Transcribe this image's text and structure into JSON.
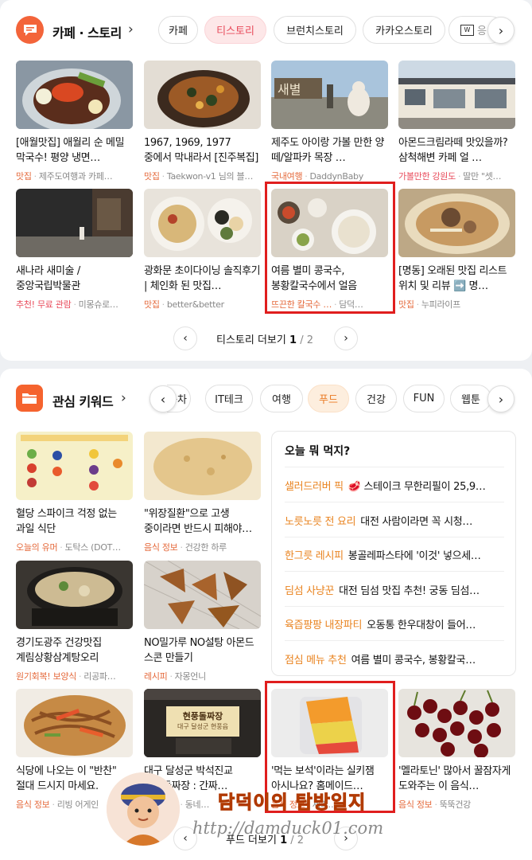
{
  "section1": {
    "title": "카페 · 스토리",
    "chips": [
      "카페",
      "티스토리",
      "브런치스토리",
      "카카오스토리",
      "응"
    ],
    "tiles": [
      {
        "title": "[애월맛집] 애월리 순 메밀 막국수! 평양 냉면…",
        "cat": "맛집",
        "author": "제주도여행과 카페…"
      },
      {
        "title": "1967, 1969, 1977 중에서 막내라서 [진주복집]으…",
        "cat": "맛집",
        "author": "Taekwon-v1 님의 블…"
      },
      {
        "title": "제주도 아이랑 가볼 만한 양 떼/알파카 목장 …",
        "cat": "국내여행",
        "author": "DaddynBaby"
      },
      {
        "title": "아몬드크림라떼 맛있을까? 삼척해변 카페 얼 …",
        "cat": "가볼만한 강원도",
        "author": "딸만 \"셋…"
      },
      {
        "title": "새나라 새미술 / 중앙국립박물관",
        "cat": "추천! 무료 관람",
        "author": "미몽슈로…"
      },
      {
        "title": "광화문 초이다이닝 솔직후기 | 체인화 된 맛집…",
        "cat": "맛집",
        "author": "better&better"
      },
      {
        "title": "여름 별미 콩국수, 봉황칼국수에서 얼음 동동…",
        "cat": "뜨끈한 칼국수 …",
        "author": "담덕…"
      },
      {
        "title": "[명동] 오래된 맛집 리스트 위치 및 리뷰 ➡️ 명…",
        "cat": "맛집",
        "author": "누피라이프"
      }
    ],
    "pager": {
      "label": "티스토리 더보기",
      "current": "1",
      "total": "/ 2"
    }
  },
  "section2": {
    "title": "관심 키워드",
    "chips": [
      "동차",
      "IT테크",
      "여행",
      "푸드",
      "건강",
      "FUN",
      "웹툰"
    ],
    "tiles": [
      {
        "title": "혈당 스파이크 걱정 없는 과일 식단",
        "cat": "오늘의 유머",
        "author": "도탁스 (DOT…"
      },
      {
        "title": "\"위장질환\"으로 고생 중이라면 반드시 피해야…",
        "cat": "음식 정보",
        "author": "건강한 하루"
      },
      {
        "title": "경기도광주 건강맛집 계림상황삼계탕오리",
        "cat": "원기회복! 보양식",
        "author": "리공파…"
      },
      {
        "title": "NO밀가루 NO설탕 아몬드 스콘 만들기",
        "cat": "레시피",
        "author": "자몽언니"
      },
      {
        "title": "식당에 나오는 이 \"반찬\" 절대 드시지 마세요.",
        "cat": "음식 정보",
        "author": "리빙 어게인"
      },
      {
        "title": "대구 달성군 박석진교 현풍돌짜장 : 간짜…",
        "cat": "맛집 탐방",
        "author": "동네…"
      },
      {
        "title": "'먹는 보석'이라는 실키잼 아시나요? 홈메이드…",
        "cat": "음식 정보",
        "author": "세리…"
      },
      {
        "title": "'멜라토닌' 많아서 꿀잠자게 도와주는 이 음식…",
        "cat": "음식 정보",
        "author": "뚝뚝건강"
      }
    ],
    "box": {
      "title": "오늘 뭐 먹지?",
      "rows": [
        {
          "k": "샐러드러버 픽",
          "v": "🥩 스테이크 무한리필이 25,9…"
        },
        {
          "k": "노릇노릇 전 요리",
          "v": "대전 사람이라면 꼭 시청…"
        },
        {
          "k": "한그릇 레시피",
          "v": "봉골레파스타에 '이것' 넣으세…"
        },
        {
          "k": "딤섬 사냥꾼",
          "v": "대전 딤섬 맛집 추천! 궁동 딤섬…"
        },
        {
          "k": "육즙팡팡 내장파티",
          "v": "오동통 한우대창이 들어…"
        },
        {
          "k": "점심 메뉴 추천",
          "v": "여름 별미 콩국수, 봉황칼국…"
        }
      ]
    },
    "pager": {
      "label": "푸드 더보기",
      "current": "1",
      "total": "/ 2"
    }
  },
  "thumb_labels": {
    "paper_text": "현풍돌짜장",
    "paper_sub": "대구 달성군 현풍읍"
  },
  "watermark": {
    "name": "담덕이의 탐방일지",
    "url": "http://damduck01.com"
  },
  "colors": {
    "tistory_red": "#e84a5a",
    "food_orange": "#ea7b25",
    "highlight": "#e01e1e",
    "brand": "#f5632e"
  }
}
